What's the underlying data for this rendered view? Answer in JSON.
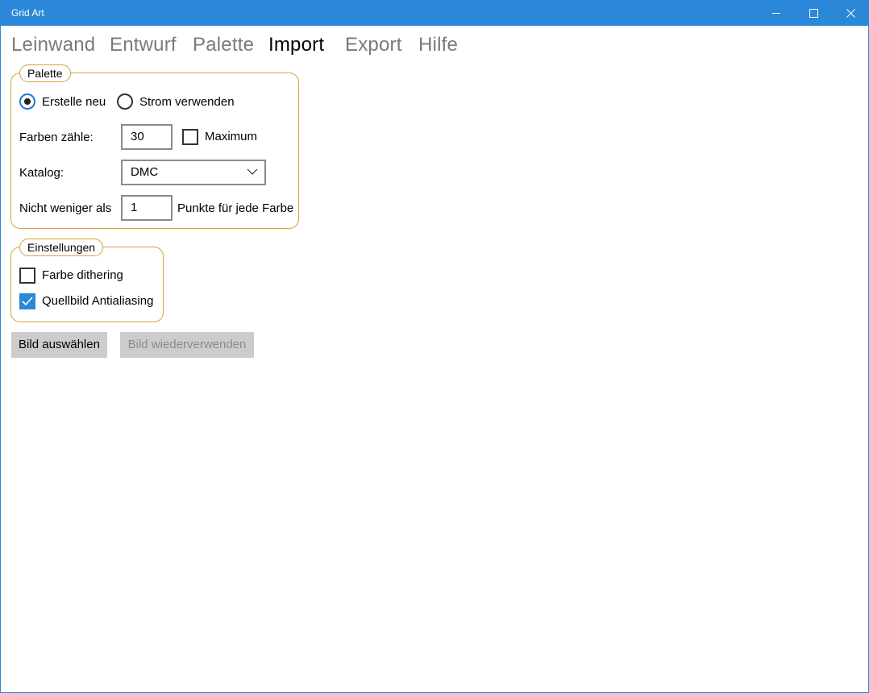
{
  "window": {
    "title": "Grid Art"
  },
  "tabs": [
    {
      "label": "Leinwand",
      "active": false
    },
    {
      "label": "Entwurf",
      "active": false
    },
    {
      "label": "Palette",
      "active": false
    },
    {
      "label": "Import",
      "active": true
    },
    {
      "label": "Export",
      "active": false
    },
    {
      "label": "Hilfe",
      "active": false
    }
  ],
  "palette_group": {
    "title": "Palette",
    "radio_new": {
      "label": "Erstelle neu",
      "checked": true
    },
    "radio_current": {
      "label": "Strom verwenden",
      "checked": false
    },
    "colors_count": {
      "label": "Farben zähle:",
      "value": "30"
    },
    "maximum": {
      "label": "Maximum",
      "checked": false
    },
    "catalog": {
      "label": "Katalog:",
      "value": "DMC"
    },
    "min_points": {
      "label": "Nicht weniger als",
      "value": "1",
      "suffix": "Punkte für jede Farbe"
    }
  },
  "settings_group": {
    "title": "Einstellungen",
    "dithering": {
      "label": "Farbe dithering",
      "checked": false
    },
    "antialiasing": {
      "label": "Quellbild Antialiasing",
      "checked": true
    }
  },
  "actions": {
    "select_image": "Bild auswählen",
    "reuse_image": "Bild wiederverwenden"
  },
  "colors": {
    "accent": "#2b88d8",
    "group_border": "#d4a437"
  }
}
